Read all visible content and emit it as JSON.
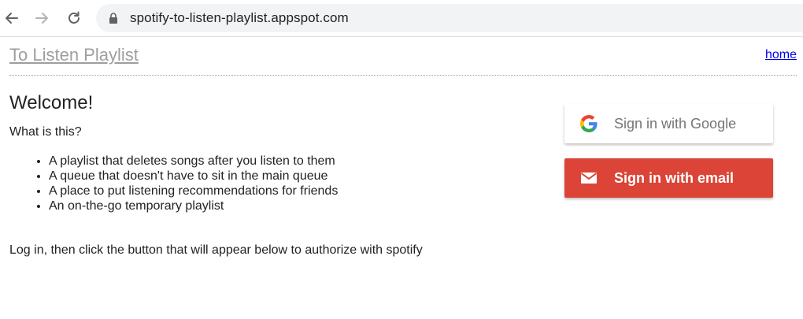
{
  "browser": {
    "url": "spotify-to-listen-playlist.appspot.com",
    "icons": [
      "back-arrow-icon",
      "forward-arrow-icon",
      "reload-icon",
      "lock-icon"
    ]
  },
  "header": {
    "site_title": "To Listen Playlist",
    "home_link": "home"
  },
  "main": {
    "welcome": "Welcome!",
    "question": "What is this?",
    "features": [
      "A playlist that deletes songs after you listen to them",
      "A queue that doesn't have to sit in the main queue",
      "A place to put listening recommendations for friends",
      "An on-the-go temporary playlist"
    ],
    "login_note": "Log in, then click the button that will appear below to authorize with spotify"
  },
  "auth": {
    "google_label": "Sign in with Google",
    "email_label": "Sign in with email",
    "google_icon": "google-g-icon",
    "email_icon": "mail-icon",
    "email_color": "#db4437"
  }
}
